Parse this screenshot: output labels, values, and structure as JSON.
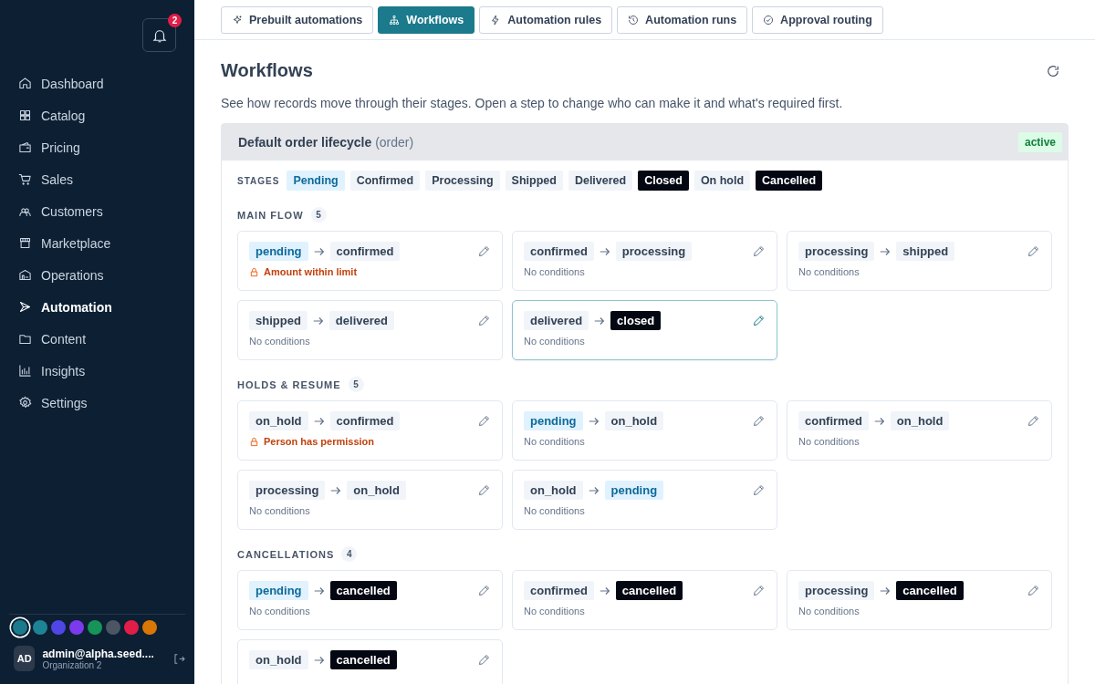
{
  "sidebar": {
    "notifications": {
      "count": "2"
    },
    "items": [
      {
        "label": "Dashboard",
        "selected": false
      },
      {
        "label": "Catalog",
        "selected": false
      },
      {
        "label": "Pricing",
        "selected": false
      },
      {
        "label": "Sales",
        "selected": false
      },
      {
        "label": "Customers",
        "selected": false
      },
      {
        "label": "Marketplace",
        "selected": false
      },
      {
        "label": "Operations",
        "selected": false
      },
      {
        "label": "Automation",
        "selected": true
      },
      {
        "label": "Content",
        "selected": false
      },
      {
        "label": "Insights",
        "selected": false
      },
      {
        "label": "Settings",
        "selected": false
      }
    ],
    "themes": [
      {
        "color": "#1b7a8c",
        "selected": true
      },
      {
        "color": "#1d8496",
        "selected": false
      },
      {
        "color": "#4f46e5",
        "selected": false
      },
      {
        "color": "#7c3aed",
        "selected": false
      },
      {
        "color": "#16945a",
        "selected": false
      },
      {
        "color": "#4b5563",
        "selected": false
      },
      {
        "color": "#e11d48",
        "selected": false
      },
      {
        "color": "#d97706",
        "selected": false
      }
    ],
    "user": {
      "initials": "AD",
      "email": "admin@alpha.seed....",
      "org": "Organization 2"
    }
  },
  "tabs": [
    {
      "label": "Prebuilt automations",
      "selected": false
    },
    {
      "label": "Workflows",
      "selected": true
    },
    {
      "label": "Automation rules",
      "selected": false
    },
    {
      "label": "Automation runs",
      "selected": false
    },
    {
      "label": "Approval routing",
      "selected": false
    }
  ],
  "page": {
    "title": "Workflows",
    "description": "See how records move through their stages. Open a step to change who can make it and what's required first."
  },
  "workflow": {
    "name": "Default order lifecycle",
    "entity": "(order)",
    "status": "active",
    "stages_label": "STAGES",
    "stages": [
      {
        "label": "Pending",
        "kind": "initial"
      },
      {
        "label": "Confirmed",
        "kind": "normal"
      },
      {
        "label": "Processing",
        "kind": "normal"
      },
      {
        "label": "Shipped",
        "kind": "normal"
      },
      {
        "label": "Delivered",
        "kind": "normal"
      },
      {
        "label": "Closed",
        "kind": "final"
      },
      {
        "label": "On hold",
        "kind": "normal"
      },
      {
        "label": "Cancelled",
        "kind": "final"
      }
    ],
    "groups": [
      {
        "title": "MAIN FLOW",
        "count": "5",
        "transitions": [
          {
            "from": {
              "label": "pending",
              "kind": "initial"
            },
            "to": {
              "label": "confirmed",
              "kind": "normal"
            },
            "condition": {
              "kind": "guard",
              "text": "Amount within limit"
            },
            "selected": false
          },
          {
            "from": {
              "label": "confirmed",
              "kind": "normal"
            },
            "to": {
              "label": "processing",
              "kind": "normal"
            },
            "condition": {
              "kind": "none",
              "text": "No conditions"
            },
            "selected": false
          },
          {
            "from": {
              "label": "processing",
              "kind": "normal"
            },
            "to": {
              "label": "shipped",
              "kind": "normal"
            },
            "condition": {
              "kind": "none",
              "text": "No conditions"
            },
            "selected": false
          },
          {
            "from": {
              "label": "shipped",
              "kind": "normal"
            },
            "to": {
              "label": "delivered",
              "kind": "normal"
            },
            "condition": {
              "kind": "none",
              "text": "No conditions"
            },
            "selected": false
          },
          {
            "from": {
              "label": "delivered",
              "kind": "normal"
            },
            "to": {
              "label": "closed",
              "kind": "final"
            },
            "condition": {
              "kind": "none",
              "text": "No conditions"
            },
            "selected": true
          }
        ]
      },
      {
        "title": "HOLDS & RESUME",
        "count": "5",
        "transitions": [
          {
            "from": {
              "label": "on_hold",
              "kind": "normal"
            },
            "to": {
              "label": "confirmed",
              "kind": "normal"
            },
            "condition": {
              "kind": "guard",
              "text": "Person has permission"
            },
            "selected": false
          },
          {
            "from": {
              "label": "pending",
              "kind": "initial"
            },
            "to": {
              "label": "on_hold",
              "kind": "normal"
            },
            "condition": {
              "kind": "none",
              "text": "No conditions"
            },
            "selected": false
          },
          {
            "from": {
              "label": "confirmed",
              "kind": "normal"
            },
            "to": {
              "label": "on_hold",
              "kind": "normal"
            },
            "condition": {
              "kind": "none",
              "text": "No conditions"
            },
            "selected": false
          },
          {
            "from": {
              "label": "processing",
              "kind": "normal"
            },
            "to": {
              "label": "on_hold",
              "kind": "normal"
            },
            "condition": {
              "kind": "none",
              "text": "No conditions"
            },
            "selected": false
          },
          {
            "from": {
              "label": "on_hold",
              "kind": "normal"
            },
            "to": {
              "label": "pending",
              "kind": "initial"
            },
            "condition": {
              "kind": "none",
              "text": "No conditions"
            },
            "selected": false
          }
        ]
      },
      {
        "title": "CANCELLATIONS",
        "count": "4",
        "transitions": [
          {
            "from": {
              "label": "pending",
              "kind": "initial"
            },
            "to": {
              "label": "cancelled",
              "kind": "final"
            },
            "condition": {
              "kind": "none",
              "text": "No conditions"
            },
            "selected": false
          },
          {
            "from": {
              "label": "confirmed",
              "kind": "normal"
            },
            "to": {
              "label": "cancelled",
              "kind": "final"
            },
            "condition": {
              "kind": "none",
              "text": "No conditions"
            },
            "selected": false
          },
          {
            "from": {
              "label": "processing",
              "kind": "normal"
            },
            "to": {
              "label": "cancelled",
              "kind": "final"
            },
            "condition": {
              "kind": "none",
              "text": "No conditions"
            },
            "selected": false
          },
          {
            "from": {
              "label": "on_hold",
              "kind": "normal"
            },
            "to": {
              "label": "cancelled",
              "kind": "final"
            },
            "selected": false
          }
        ]
      }
    ]
  }
}
